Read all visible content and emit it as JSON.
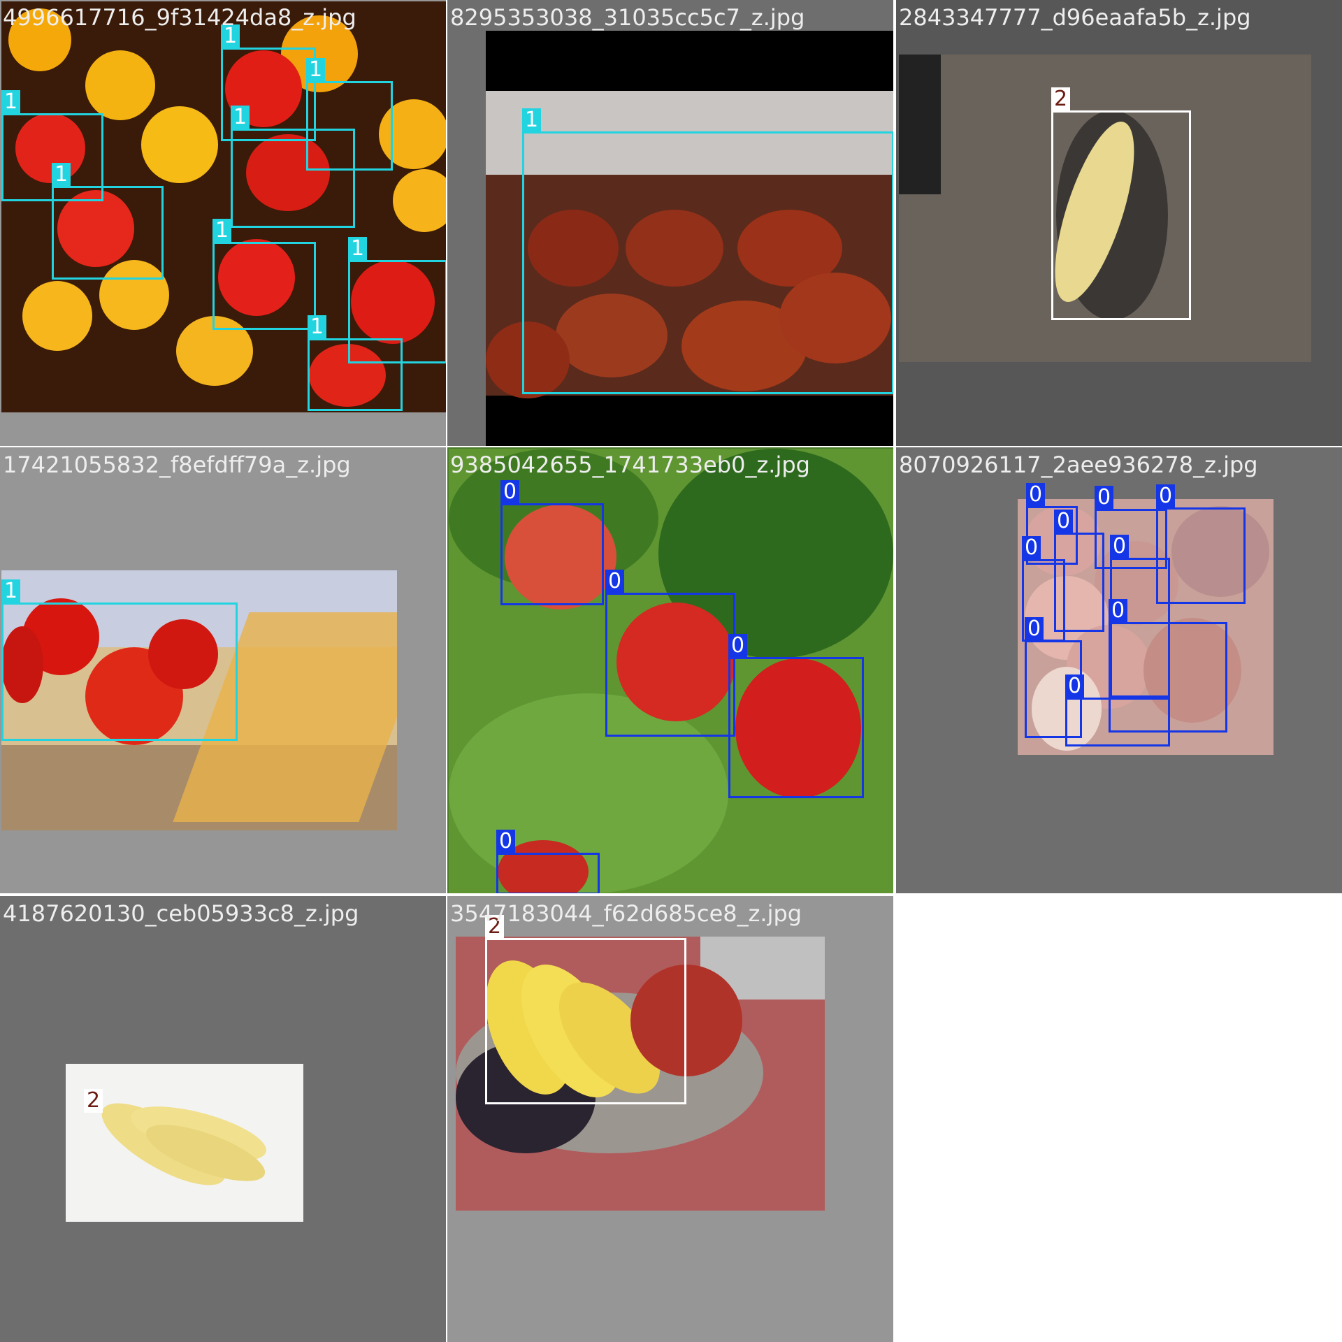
{
  "cells": [
    {
      "filename": "4996617716_9f31424da8_z.jpg",
      "boxes": [
        "1",
        "1",
        "1",
        "1",
        "1",
        "1",
        "1",
        "1",
        "1"
      ]
    },
    {
      "filename": "8295353038_31035cc5c7_z.jpg",
      "boxes": [
        "1"
      ]
    },
    {
      "filename": "2843347777_d96eaafa5b_z.jpg",
      "boxes": [
        "2"
      ]
    },
    {
      "filename": "17421055832_f8efdff79a_z.jpg",
      "boxes": [
        "1"
      ]
    },
    {
      "filename": "9385042655_1741733eb0_z.jpg",
      "boxes": [
        "0",
        "0",
        "0",
        "0"
      ]
    },
    {
      "filename": "8070926117_2aee936278_z.jpg",
      "boxes": [
        "0",
        "0",
        "0",
        "0",
        "0",
        "0",
        "0",
        "0",
        "0"
      ]
    },
    {
      "filename": "4187620130_ceb05933c8_z.jpg",
      "boxes": [
        "2"
      ]
    },
    {
      "filename": "3547183044_f62d685ce8_z.jpg",
      "boxes": [
        "2"
      ]
    }
  ],
  "colors": {
    "class_0": "#1436e6",
    "class_1": "#22d3e0",
    "class_2": "#ffffff",
    "gray_dark": "#6e6e6e",
    "gray_light": "#969696"
  }
}
